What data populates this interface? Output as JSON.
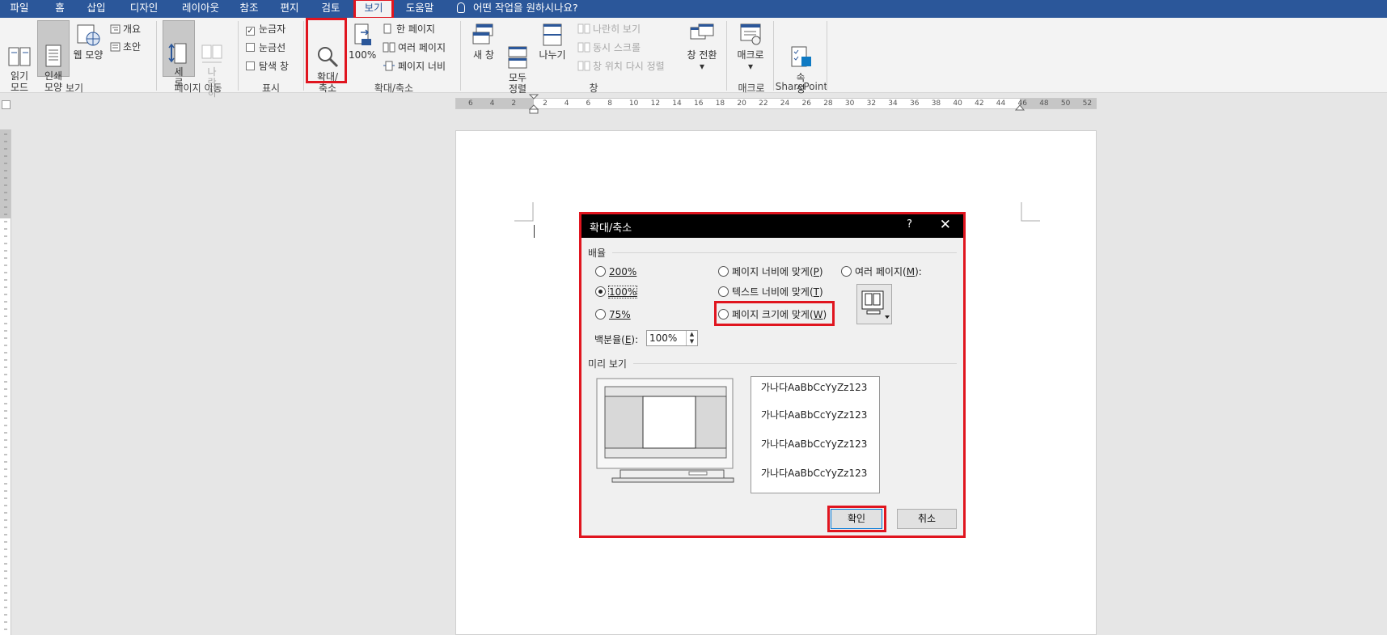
{
  "tabs": [
    "파일",
    "홈",
    "삽입",
    "디자인",
    "레이아웃",
    "참조",
    "편지",
    "검토",
    "보기",
    "도움말"
  ],
  "tell_me": "어떤 작업을 원하시나요?",
  "ribbon": {
    "views": {
      "read_mode": "읽기\n모드",
      "print_layout": "인쇄\n모양",
      "web_layout": "웹 모양",
      "outline": "개요",
      "draft": "초안",
      "group": "보기"
    },
    "page_move": {
      "vertical": "세\n로",
      "side_by_side": "나\n란\n히",
      "group": "페이지 이동"
    },
    "show": {
      "ruler": "눈금자",
      "gridlines": "눈금선",
      "nav_pane": "탐색 창",
      "group": "표시"
    },
    "zoom": {
      "zoom": "확대/\n축소",
      "hundred": "100%",
      "one_page": "한 페이지",
      "multiple_pages": "여러 페이지",
      "page_width": "페이지 너비",
      "group": "확대/축소"
    },
    "window": {
      "new_window": "새 창",
      "arrange_all": "모두\n정렬",
      "split": "나누기",
      "side_by_side": "나란히 보기",
      "sync_scroll": "동시 스크롤",
      "reset_position": "창 위치 다시 정렬",
      "switch_windows": "창 전환",
      "group": "창"
    },
    "macros": {
      "macros": "매크로",
      "group": "매크로"
    },
    "sharepoint": {
      "properties": "속\n성",
      "group": "SharePoint"
    }
  },
  "ruler_labels": [
    "6",
    "4",
    "2",
    "2",
    "4",
    "6",
    "8",
    "10",
    "12",
    "14",
    "16",
    "18",
    "20",
    "22",
    "24",
    "26",
    "28",
    "30",
    "32",
    "34",
    "36",
    "38",
    "40",
    "42",
    "44",
    "46",
    "48",
    "50",
    "52"
  ],
  "dialog": {
    "title": "확대/축소",
    "help": "?",
    "close": "✕",
    "zoom_to_label": "배율",
    "opt_200": "200%",
    "opt_100": "100%",
    "opt_75": "75%",
    "opt_page_width": "페이지 너비에 맞게(",
    "opt_page_width_key": "P",
    "opt_text_width": "텍스트 너비에 맞게(",
    "opt_text_width_key": "T",
    "opt_whole_page": "페이지 크기에 맞게(",
    "opt_whole_page_key": "W",
    "opt_many_pages": "여러 페이지(",
    "opt_many_pages_key": "M",
    "percent_label": "백분율(",
    "percent_key": "E",
    "percent_value": "100%",
    "preview_label": "미리 보기",
    "sample_text": [
      "가나다AaBbCcYyZz123",
      "가나다AaBbCcYyZz123",
      "가나다AaBbCcYyZz123",
      "가나다AaBbCcYyZz123"
    ],
    "ok": "확인",
    "cancel": "취소"
  },
  "accent_color": "#2b579a",
  "highlight_color": "#e0151f"
}
